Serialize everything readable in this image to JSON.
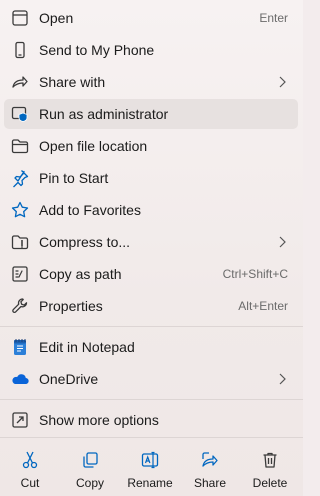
{
  "menu": {
    "items": [
      {
        "label": "Open",
        "shortcut": "Enter",
        "icon": "open-window-icon"
      },
      {
        "label": "Send to My Phone",
        "icon": "phone-icon"
      },
      {
        "label": "Share with",
        "icon": "share-arrow-icon",
        "submenu": true
      },
      {
        "label": "Run as administrator",
        "icon": "admin-shield-icon",
        "highlighted": true
      },
      {
        "label": "Open file location",
        "icon": "folder-icon"
      },
      {
        "label": "Pin to Start",
        "icon": "pin-icon"
      },
      {
        "label": "Add to Favorites",
        "icon": "star-icon"
      },
      {
        "label": "Compress to...",
        "icon": "zip-folder-icon",
        "submenu": true
      },
      {
        "label": "Copy as path",
        "shortcut": "Ctrl+Shift+C",
        "icon": "copy-path-icon"
      },
      {
        "label": "Properties",
        "shortcut": "Alt+Enter",
        "icon": "wrench-icon"
      },
      {
        "label": "Edit in Notepad",
        "icon": "notepad-icon"
      },
      {
        "label": "OneDrive",
        "icon": "onedrive-cloud-icon",
        "submenu": true
      },
      {
        "label": "Show more options",
        "icon": "more-options-icon"
      }
    ],
    "bottom_actions": [
      {
        "label": "Cut",
        "icon": "scissors-icon"
      },
      {
        "label": "Copy",
        "icon": "copy-icon"
      },
      {
        "label": "Rename",
        "icon": "rename-icon"
      },
      {
        "label": "Share",
        "icon": "share-icon"
      },
      {
        "label": "Delete",
        "icon": "trash-icon"
      }
    ],
    "colors": {
      "accent": "#0067c0",
      "onedrive": "#0a64d8",
      "highlight": "#e7e1e0"
    }
  }
}
